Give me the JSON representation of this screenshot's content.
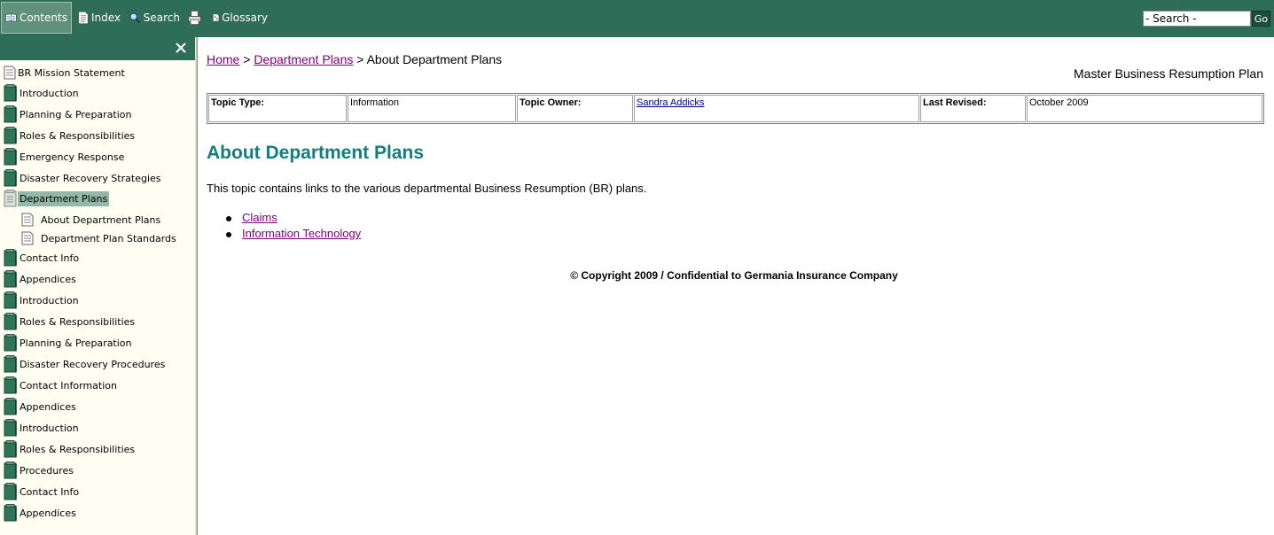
{
  "toolbar": {
    "contents": "Contents",
    "index": "Index",
    "search": "Search",
    "glossary": "Glossary",
    "search_placeholder": "- Search -",
    "go": "Go"
  },
  "sidebar": {
    "items": [
      {
        "label": "BR Mission Statement",
        "icon": "page-icon",
        "level": 0
      },
      {
        "label": "Introduction",
        "icon": "book-icon",
        "level": 0
      },
      {
        "label": "Planning & Preparation",
        "icon": "book-icon",
        "level": 0
      },
      {
        "label": "Roles & Responsibilities",
        "icon": "book-icon",
        "level": 0
      },
      {
        "label": "Emergency Response",
        "icon": "book-icon",
        "level": 0
      },
      {
        "label": "Disaster Recovery Strategies",
        "icon": "book-icon",
        "level": 0
      },
      {
        "label": "Department Plans",
        "icon": "open-book-icon",
        "level": 0,
        "selected": true
      },
      {
        "label": "About Department Plans",
        "icon": "page-icon",
        "level": 1
      },
      {
        "label": "Department Plan Standards",
        "icon": "page-icon",
        "level": 1
      },
      {
        "label": "Contact Info",
        "icon": "book-icon",
        "level": 0
      },
      {
        "label": "Appendices",
        "icon": "book-icon",
        "level": 0
      },
      {
        "label": "Introduction",
        "icon": "book-icon",
        "level": 0
      },
      {
        "label": "Roles & Responsibilities",
        "icon": "book-icon",
        "level": 0
      },
      {
        "label": "Planning & Preparation",
        "icon": "book-icon",
        "level": 0
      },
      {
        "label": "Disaster Recovery Procedures",
        "icon": "book-icon",
        "level": 0
      },
      {
        "label": "Contact Information",
        "icon": "book-icon",
        "level": 0
      },
      {
        "label": "Appendices",
        "icon": "book-icon",
        "level": 0
      },
      {
        "label": "Introduction",
        "icon": "book-icon",
        "level": 0
      },
      {
        "label": "Roles & Responsibilities",
        "icon": "book-icon",
        "level": 0
      },
      {
        "label": "Procedures",
        "icon": "book-icon",
        "level": 0
      },
      {
        "label": "Contact Info",
        "icon": "book-icon",
        "level": 0
      },
      {
        "label": "Appendices",
        "icon": "book-icon",
        "level": 0
      }
    ]
  },
  "main": {
    "breadcrumb": {
      "home": "Home",
      "sep1": ">",
      "dept": "Department Plans",
      "sep2": ">",
      "current": "About Department Plans"
    },
    "doc_title": "Master Business Resumption Plan",
    "meta": {
      "topic_type_label": "Topic Type:",
      "topic_type": "Information",
      "topic_owner_label": "Topic Owner:",
      "topic_owner": "Sandra Addicks",
      "last_revised_label": "Last Revised:",
      "last_revised": "October 2009"
    },
    "heading": "About Department Plans",
    "intro": "This topic contains links to the various departmental Business Resumption (BR) plans.",
    "links": [
      "Claims",
      "Information Technology"
    ],
    "copyright": "© Copyright 2009 / Confidential to Germania Insurance Company"
  },
  "colors": {
    "toolbar_bg": "#2e6e58",
    "sidebar_bg": "#fefef2",
    "heading": "#0f7f7f",
    "visited_link": "#800080",
    "owner_link": "#00008b",
    "book_green": "#2f7557"
  }
}
